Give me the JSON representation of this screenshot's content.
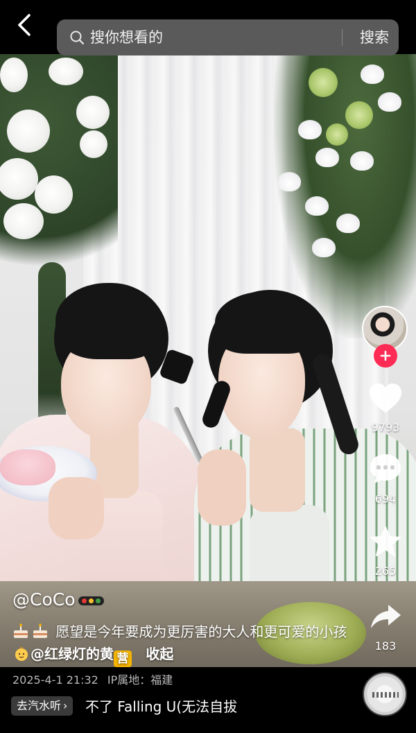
{
  "search": {
    "placeholder": "搜你想看的",
    "button_label": "搜索"
  },
  "rail": {
    "likes": "9793",
    "comments": "694",
    "favorites": "265",
    "shares": "183"
  },
  "post": {
    "author": "@CoCo",
    "description_text": "愿望是今年要成为更厉害的大人和更可爱的小孩",
    "mention": "@红绿灯的黄",
    "collapse_label": "收起",
    "date": "2025-4-1 21:32",
    "ip_location": "IP属地：福建"
  },
  "music": {
    "tag_label": "去汽水听",
    "track": "不了    Falling U(无法自拔"
  },
  "colors": {
    "follow": "#fe2c55",
    "search_bg": "#5a5a5a",
    "background": "#000000"
  },
  "icons": [
    "back-arrow-icon",
    "search-icon",
    "plus-icon",
    "heart-icon",
    "comment-icon",
    "star-icon",
    "share-icon",
    "cake-emoji",
    "baby-emoji",
    "traffic-light-icon",
    "music-disc"
  ]
}
